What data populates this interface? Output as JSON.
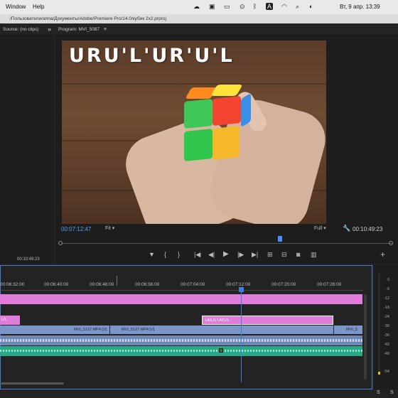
{
  "menubar": {
    "items": [
      "Window",
      "Help"
    ],
    "status_icons": [
      "cloud-icon",
      "screen-record-icon",
      "battery-icon",
      "play-icon",
      "bluetooth-icon",
      "text-input-icon",
      "wifi-icon",
      "search-icon",
      "control-center-icon"
    ],
    "input_letter": "A",
    "datetime": "Вт, 9 апр.  13:39"
  },
  "pathbar": {
    "path": "/Пользователи/anna/Документы/Adobe/Premiere Pro/14.0/кубик 2x2.prproj"
  },
  "source_panel": {
    "title": "Source: (no clips)",
    "menu": "»",
    "timecode": "00:10:49:23"
  },
  "program_panel": {
    "title": "Program: MVI_5087",
    "menu_icon": "≡",
    "overlay_text": "URU'L'UR'U'L",
    "current_timecode": "00:07:12:47",
    "fit_label": "Fit",
    "quality_label": "Full",
    "duration_timecode": "00:10:49:23",
    "transport_icons": [
      "marker-icon",
      "mark-in-icon",
      "mark-out-icon",
      "go-to-in-icon",
      "step-back-icon",
      "play-icon",
      "step-forward-icon",
      "go-to-out-icon",
      "lift-icon",
      "extract-icon",
      "export-frame-icon",
      "compare-icon",
      "add-button-icon"
    ]
  },
  "timeline": {
    "ruler_labels": [
      "00:06:32:00",
      "00:06:40:00",
      "00:06:48:00",
      "00:06:56:00",
      "00:07:04:00",
      "00:07:12:00",
      "00:07:20:00",
      "00:07:28:00"
    ],
    "v2_clips": [
      "U'L",
      "URU'L'UR'U'L"
    ],
    "v1_clips": [
      "MVI_5127.MP4 [V]",
      "MVI_5127.MP4 [V]",
      "MVI_5"
    ],
    "playhead_color": "#3f7fd9",
    "track_colors": {
      "title": "#e07cd9",
      "video": "#7b97c9",
      "audio": "#2aa88a"
    }
  },
  "meters": {
    "db_labels": [
      "0",
      "-6",
      "-12",
      "-18",
      "-24",
      "-30",
      "-36",
      "-42",
      "-48",
      "-54"
    ],
    "bottom_left": "S",
    "bottom_right": "S"
  }
}
